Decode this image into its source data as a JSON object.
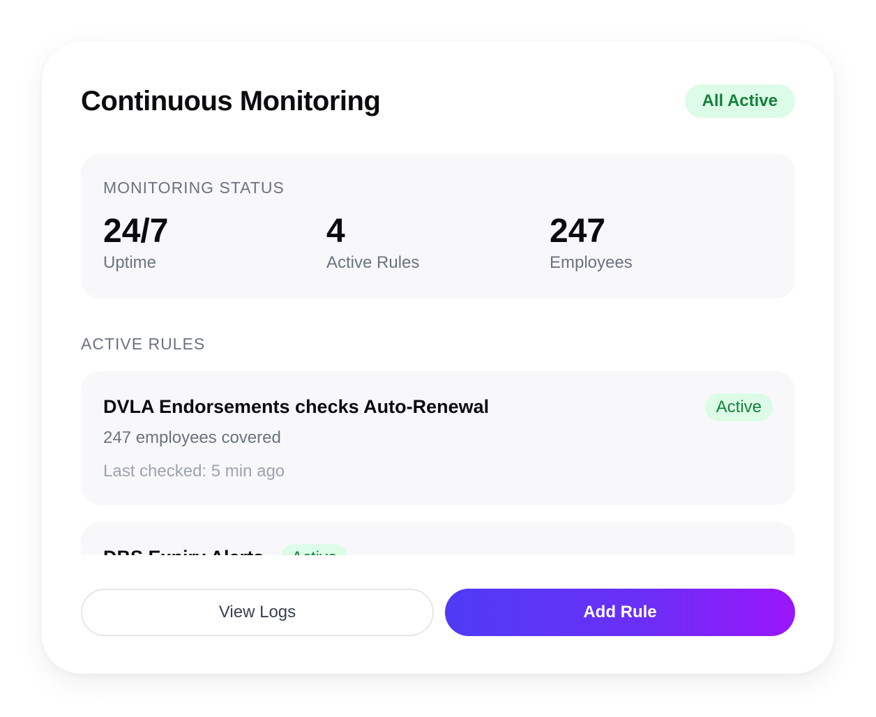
{
  "header": {
    "title": "Continuous Monitoring",
    "status_badge": "All Active"
  },
  "status": {
    "label": "MONITORING STATUS",
    "stats": [
      {
        "value": "24/7",
        "label": "Uptime"
      },
      {
        "value": "4",
        "label": "Active Rules"
      },
      {
        "value": "247",
        "label": "Employees"
      }
    ]
  },
  "rules": {
    "label": "ACTIVE RULES",
    "items": [
      {
        "title": "DVLA Endorsements checks Auto-Renewal",
        "badge": "Active",
        "coverage": "247 employees covered",
        "last_checked": "Last checked: 5 min ago"
      },
      {
        "title": "DBS Expiry Alerts",
        "badge": "Active"
      }
    ]
  },
  "actions": {
    "view_logs": "View Logs",
    "add_rule": "Add Rule"
  },
  "colors": {
    "accent_gradient_start": "#4f3bf6",
    "accent_gradient_end": "#9a16f8",
    "badge_bg": "#dcfce7",
    "badge_text": "#15803d",
    "panel_bg": "#f8f8fa"
  }
}
